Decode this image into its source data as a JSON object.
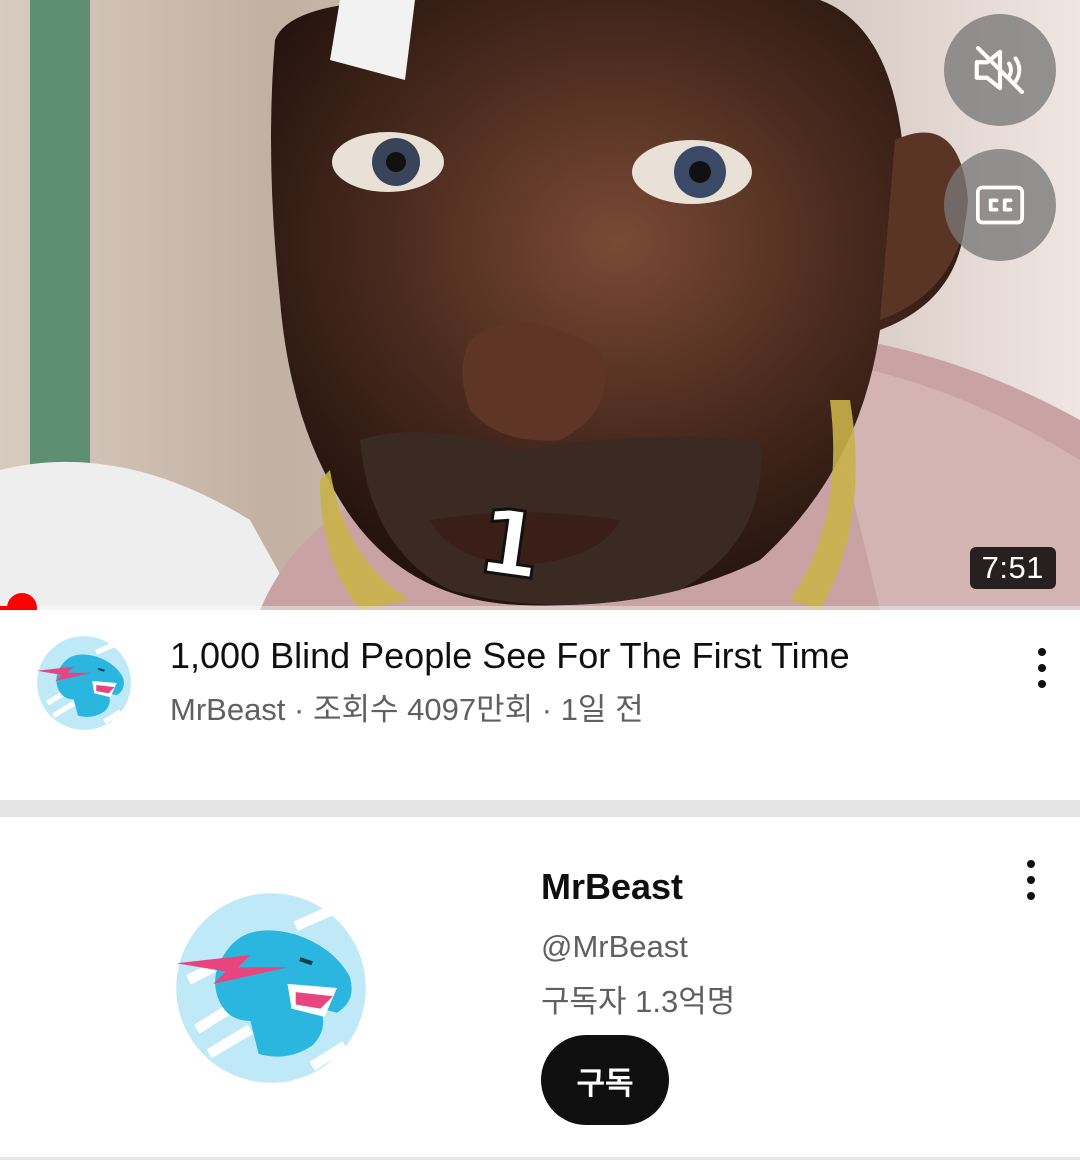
{
  "video": {
    "title": "1,000 Blind People See For The First Time",
    "meta": "MrBeast · 조회수 4097만회 · 1일 전",
    "duration": "7:51",
    "overlay_caption": "1",
    "playback_progress_fraction": 0.02
  },
  "overlay_icons": {
    "mute": "volume-off-icon",
    "cc": "closed-captions-icon"
  },
  "channel": {
    "name": "MrBeast",
    "handle": "@MrBeast",
    "subscribers": "구독자 1.3억명",
    "subscribe_label": "구독"
  },
  "colors": {
    "progress": "#ff0000",
    "avatar_blue": "#2bb6e0",
    "bolt_pink": "#e8457e",
    "subscribe_bg": "#0f0f0f"
  }
}
